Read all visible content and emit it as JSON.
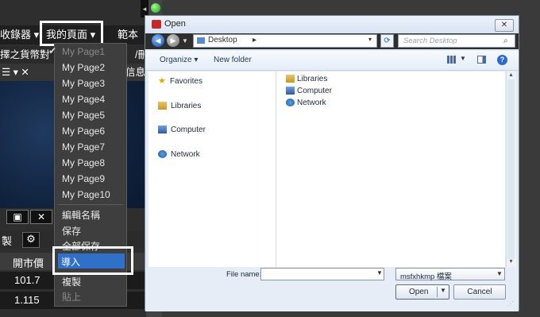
{
  "app": {
    "menubar": {
      "item1": "收錄器 ▾",
      "mypage": "我的頁面 ▾",
      "item3": "範本"
    },
    "row2": {
      "left": "擇之貨幣對",
      "right": "/刪"
    },
    "row3": {
      "left": "☰ ▾ ✕",
      "right": "信息"
    },
    "window_buttons": {
      "maximize": "▣",
      "close": "✕"
    },
    "mid_bar": {
      "left": "製",
      "gear": "⚙"
    },
    "table": {
      "header": "開市價",
      "rows": [
        "101.7",
        "1.115"
      ]
    }
  },
  "dropdown": {
    "pages": [
      "My Page1",
      "My Page2",
      "My Page3",
      "My Page4",
      "My Page5",
      "My Page6",
      "My Page7",
      "My Page8",
      "My Page9",
      "My Page10"
    ],
    "checked_mark": "✔",
    "actions": {
      "rename": "編輯名稱",
      "save": "保存",
      "save_all": "全部保存",
      "import": "導入",
      "copy": "複製",
      "paste": "貼上"
    }
  },
  "collapse_arrow": "◂",
  "dialog": {
    "title": "Open",
    "close": "✕",
    "address": {
      "path": "Desktop",
      "sep": "▸",
      "drop": "▾"
    },
    "search_placeholder": "Search Desktop",
    "toolbar": {
      "organize": "Organize ▾",
      "new_folder": "New folder"
    },
    "nav": {
      "favorites": "Favorites",
      "libraries": "Libraries",
      "computer": "Computer",
      "network": "Network"
    },
    "files": [
      "Libraries",
      "Computer",
      "Network"
    ],
    "file_name_label": "File name:",
    "file_name_value": "",
    "filter": "msfxhkmp 檔案",
    "open": "Open",
    "cancel": "Cancel"
  }
}
